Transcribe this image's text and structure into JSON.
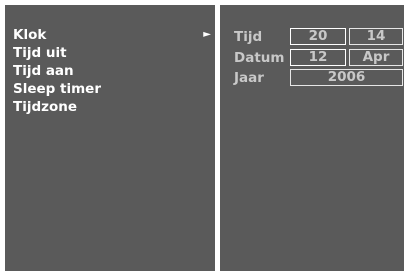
{
  "menu": {
    "items": [
      {
        "label": "Klok",
        "arrow": "►"
      },
      {
        "label": "Tijd uit"
      },
      {
        "label": "Tijd aan"
      },
      {
        "label": "Sleep timer"
      },
      {
        "label": "Tijdzone"
      }
    ]
  },
  "settings": {
    "time": {
      "label": "Tijd",
      "hour": "20",
      "minute": "14"
    },
    "date": {
      "label": "Datum",
      "day": "12",
      "month": "Apr"
    },
    "year": {
      "label": "Jaar",
      "value": "2006"
    }
  },
  "colors": {
    "panel_bg": "#5a5a5a",
    "text_primary": "#ffffff",
    "text_secondary": "#c8c8c8",
    "border": "#e6e6e6"
  }
}
